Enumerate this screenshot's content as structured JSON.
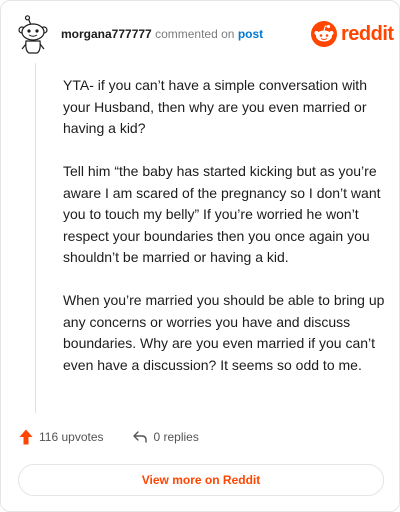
{
  "header": {
    "username": "morgana777777",
    "commented_on": "commented on",
    "post_link": "post",
    "brand_text": "reddit",
    "brand_color": "#ff4500"
  },
  "comment": {
    "paragraphs": [
      "YTA- if you can’t have a simple conversation with your Husband, then why are you even married or having a kid?",
      "Tell him “the baby has started kicking but as you’re aware I am scared of the pregnancy so I don’t want you to touch my belly” If you’re worried he won’t respect your boundaries then you once again you shouldn’t be married or having a kid.",
      "When you’re married you should be able to bring up any concerns or worries you have and discuss boundaries. Why are you even married if you can’t even have a discussion? It seems so odd to me."
    ]
  },
  "actions": {
    "upvotes_label": "116 upvotes",
    "replies_label": "0 replies",
    "upvote_icon": "upvote-arrow-icon",
    "reply_icon": "reply-arrow-icon"
  },
  "footer": {
    "view_button_label": "View more on Reddit"
  }
}
